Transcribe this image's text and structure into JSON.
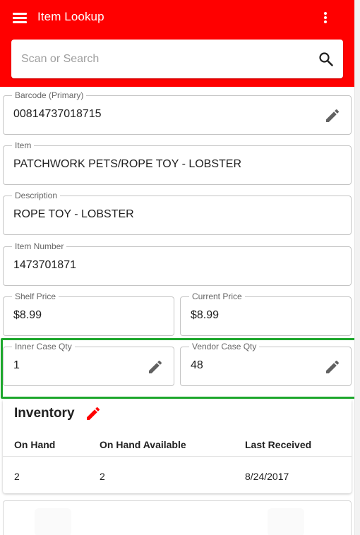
{
  "app": {
    "title": "Item Lookup",
    "accent_color": "#ff0000",
    "highlight_color": "#1da72c",
    "menu_icon": "hamburger-menu-icon",
    "more_icon": "more-vert-icon"
  },
  "search": {
    "placeholder": "Scan or Search",
    "value": "",
    "icon": "search-icon"
  },
  "fields": {
    "barcode": {
      "label": "Barcode (Primary)",
      "value": "00814737018715",
      "editable": true
    },
    "item": {
      "label": "Item",
      "value": "PATCHWORK PETS/ROPE TOY - LOBSTER"
    },
    "description": {
      "label": "Description",
      "value": "ROPE TOY - LOBSTER"
    },
    "item_number": {
      "label": "Item Number",
      "value": "1473701871"
    },
    "shelf_price": {
      "label": "Shelf Price",
      "value": "$8.99"
    },
    "current_price": {
      "label": "Current Price",
      "value": "$8.99"
    },
    "inner_case_qty": {
      "label": "Inner Case Qty",
      "value": "1",
      "editable": true
    },
    "vendor_case_qty": {
      "label": "Vendor Case Qty",
      "value": "48",
      "editable": true
    }
  },
  "inventory": {
    "title": "Inventory",
    "columns": [
      "On Hand",
      "On Hand Available",
      "Last Received"
    ],
    "rows": [
      [
        "2",
        "2",
        "8/24/2017"
      ]
    ]
  }
}
